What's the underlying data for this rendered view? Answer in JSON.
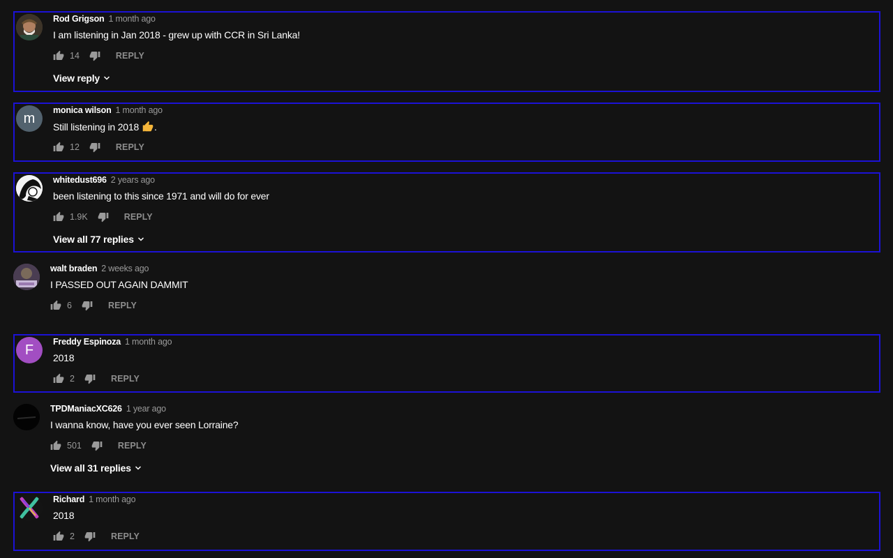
{
  "comments": [
    {
      "author": "Rod Grigson",
      "time": "1 month ago",
      "text": "I am listening in Jan 2018 - grew up with CCR in Sri Lanka!",
      "likes": "14",
      "reply_label": "REPLY",
      "view_replies": "View reply",
      "avatar_letter": "",
      "avatar_color": "#5a4a3a"
    },
    {
      "author": "monica wilson",
      "time": "1 month ago",
      "text": "Still listening in 2018",
      "text_suffix": ".",
      "emoji_icon": "thumbs-up-emoji",
      "likes": "12",
      "reply_label": "REPLY",
      "avatar_letter": "m",
      "avatar_color": "#52626e"
    },
    {
      "author": "whitedust696",
      "time": "2 years ago",
      "text": "been listening to this since 1971 and will do for ever",
      "likes": "1.9K",
      "reply_label": "REPLY",
      "view_replies": "View all 77 replies",
      "avatar_letter": "",
      "avatar_color": "#ffffff"
    },
    {
      "author": "walt braden",
      "time": "2 weeks ago",
      "text": "I PASSED OUT AGAIN  DAMMIT",
      "likes": "6",
      "reply_label": "REPLY",
      "avatar_letter": "",
      "avatar_color": "#6b5a7a"
    },
    {
      "author": "Freddy Espinoza",
      "time": "1 month ago",
      "text": "2018",
      "likes": "2",
      "reply_label": "REPLY",
      "avatar_letter": "F",
      "avatar_color": "#a24ec2"
    },
    {
      "author": "TPDManiacXC626",
      "time": "1 year ago",
      "text": "I wanna know, have you ever seen Lorraine?",
      "likes": "501",
      "reply_label": "REPLY",
      "view_replies": "View all 31 replies",
      "avatar_letter": "",
      "avatar_color": "#050505"
    },
    {
      "author": "Richard",
      "time": "1 month ago",
      "text": "2018",
      "likes": "2",
      "reply_label": "REPLY",
      "avatar_letter": "",
      "avatar_color": "#1a1a1a"
    }
  ],
  "colors": {
    "background": "#131313",
    "highlight_border": "#1c12d6",
    "secondary_text": "#9a9a9a"
  }
}
